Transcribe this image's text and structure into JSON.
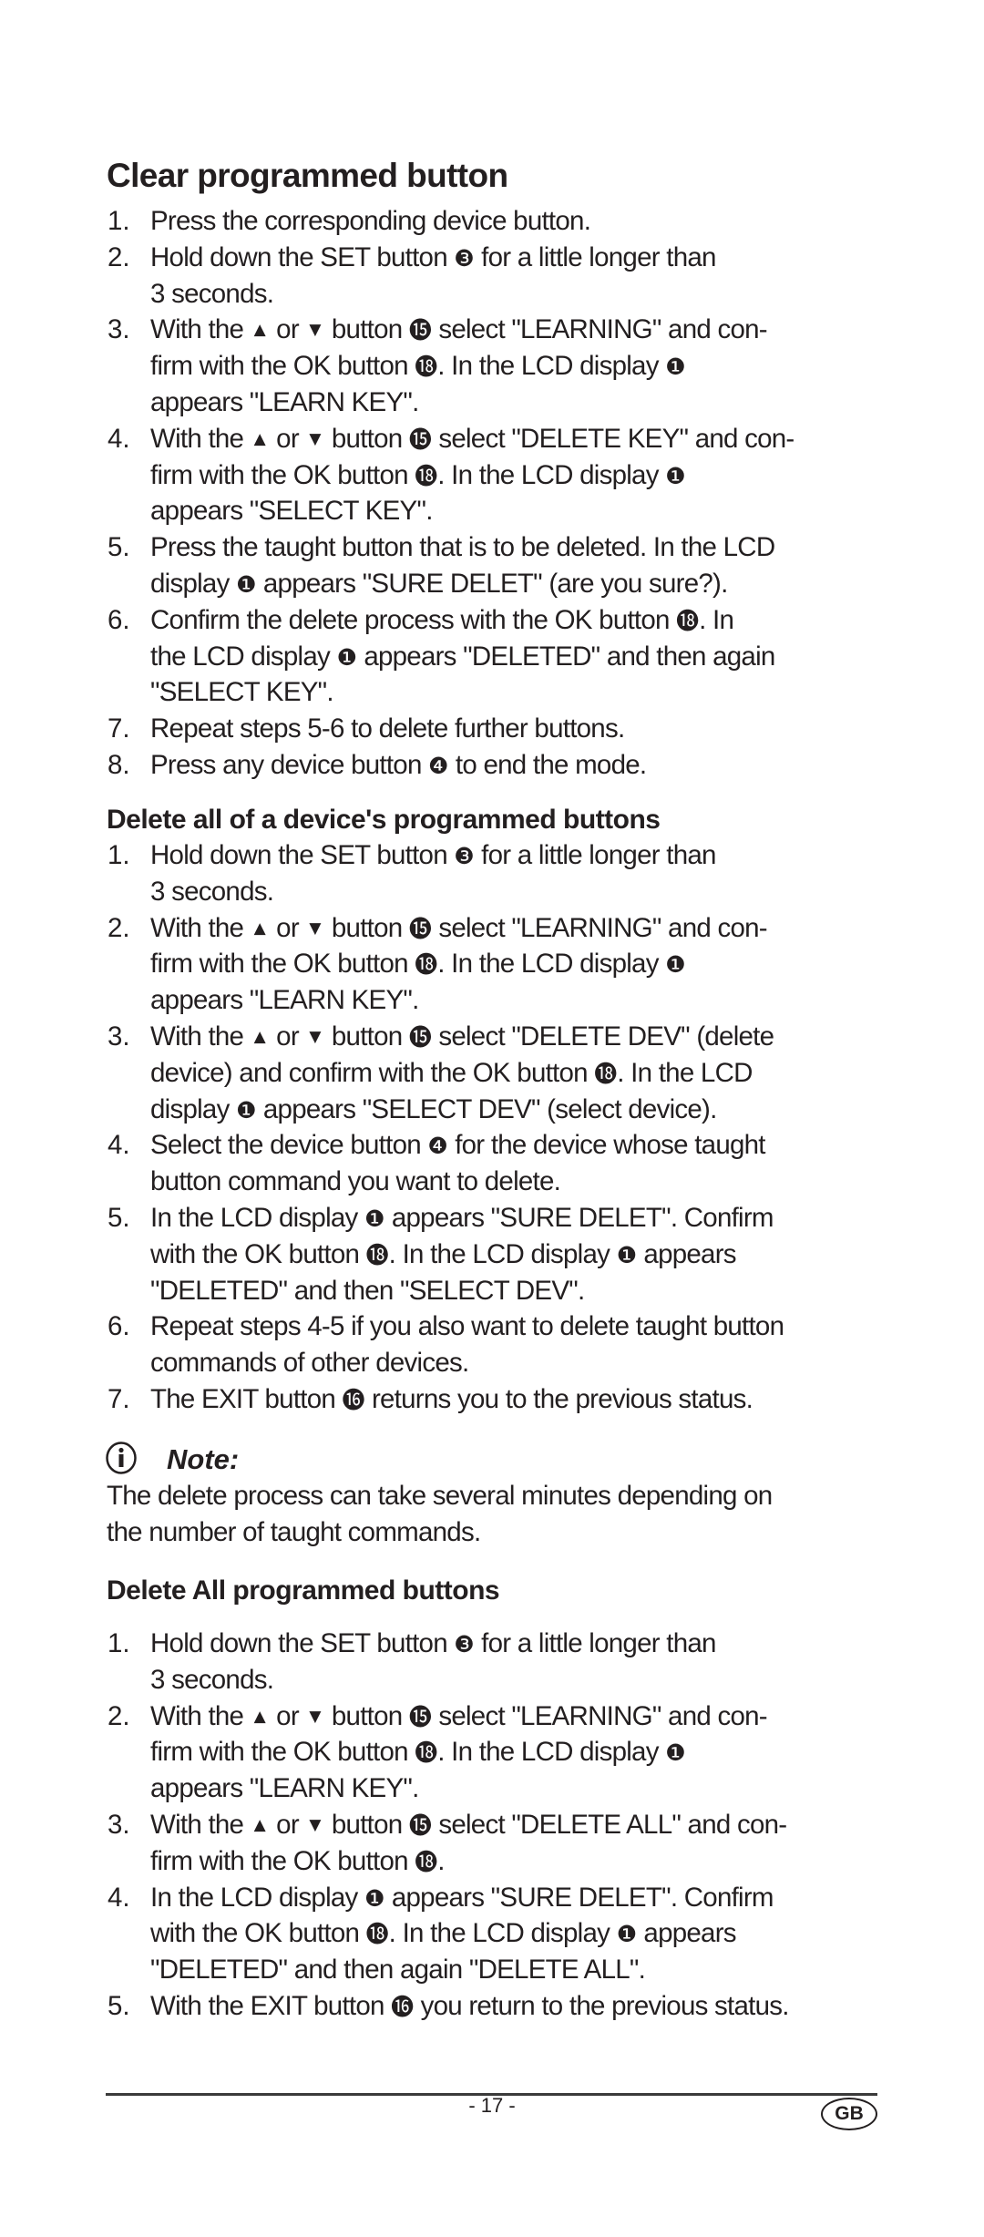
{
  "sections": [
    {
      "title": "Clear programmed button",
      "steps": [
        {
          "num": "1.",
          "lines": [
            [
              "Press the corresponding device button."
            ]
          ]
        },
        {
          "num": "2.",
          "lines": [
            [
              "Hold down the SET button ",
              {
                "ref": "3"
              },
              " for a little longer than"
            ],
            [
              "3 seconds."
            ]
          ]
        },
        {
          "num": "3.",
          "lines": [
            [
              "With the ",
              {
                "arrow": "up"
              },
              " or ",
              {
                "arrow": "down"
              },
              " button ",
              {
                "ref": "15"
              },
              " select \"LEARNING\" and con-"
            ],
            [
              "firm with the OK button ",
              {
                "ref": "18"
              },
              ". In the LCD display ",
              {
                "ref": "1"
              }
            ],
            [
              "appears \"LEARN KEY\"."
            ]
          ]
        },
        {
          "num": "4.",
          "lines": [
            [
              "With the ",
              {
                "arrow": "up"
              },
              " or ",
              {
                "arrow": "down"
              },
              " button ",
              {
                "ref": "15"
              },
              " select \"DELETE KEY\" and con-"
            ],
            [
              "firm with the OK button ",
              {
                "ref": "18"
              },
              ". In the LCD display ",
              {
                "ref": "1"
              }
            ],
            [
              "appears \"SELECT KEY\"."
            ]
          ]
        },
        {
          "num": "5.",
          "lines": [
            [
              "Press the taught button that is to be deleted. In the LCD"
            ],
            [
              "display ",
              {
                "ref": "1"
              },
              " appears \"SURE DELET\" (are you sure?)."
            ]
          ]
        },
        {
          "num": "6.",
          "lines": [
            [
              "Confirm the delete process with the OK button ",
              {
                "ref": "18"
              },
              ". In"
            ],
            [
              "the LCD display ",
              {
                "ref": "1"
              },
              " appears \"DELETED\" and then again"
            ],
            [
              "\"SELECT KEY\"."
            ]
          ]
        },
        {
          "num": "7.",
          "lines": [
            [
              "Repeat steps 5-6 to delete further buttons."
            ]
          ]
        },
        {
          "num": "8.",
          "lines": [
            [
              "Press any device button ",
              {
                "ref": "4"
              },
              " to end the mode."
            ]
          ]
        }
      ]
    },
    {
      "title": "Delete all of a device's programmed buttons",
      "steps": [
        {
          "num": "1.",
          "lines": [
            [
              "Hold down the SET button ",
              {
                "ref": "3"
              },
              " for a little longer than"
            ],
            [
              "3 seconds."
            ]
          ]
        },
        {
          "num": "2.",
          "lines": [
            [
              "With the ",
              {
                "arrow": "up"
              },
              " or ",
              {
                "arrow": "down"
              },
              " button ",
              {
                "ref": "15"
              },
              " select \"LEARNING\" and con-"
            ],
            [
              "firm with the OK button ",
              {
                "ref": "18"
              },
              ". In the LCD display ",
              {
                "ref": "1"
              }
            ],
            [
              "appears \"LEARN KEY\"."
            ]
          ]
        },
        {
          "num": "3.",
          "lines": [
            [
              "With the ",
              {
                "arrow": "up"
              },
              " or ",
              {
                "arrow": "down"
              },
              " button ",
              {
                "ref": "15"
              },
              " select \"DELETE DEV\" (delete"
            ],
            [
              "device) and confirm with the OK button ",
              {
                "ref": "18"
              },
              ". In the LCD"
            ],
            [
              "display ",
              {
                "ref": "1"
              },
              " appears \"SELECT DEV\" (select device)."
            ]
          ]
        },
        {
          "num": "4.",
          "lines": [
            [
              "Select the device button ",
              {
                "ref": "4"
              },
              " for the device whose taught"
            ],
            [
              "button command you want to delete."
            ]
          ]
        },
        {
          "num": "5.",
          "lines": [
            [
              "In the LCD display ",
              {
                "ref": "1"
              },
              " appears \"SURE DELET\". Confirm"
            ],
            [
              "with the OK button ",
              {
                "ref": "18"
              },
              ". In the LCD display ",
              {
                "ref": "1"
              },
              " appears"
            ],
            [
              "\"DELETED\" and then \"SELECT DEV\"."
            ]
          ]
        },
        {
          "num": "6.",
          "lines": [
            [
              "Repeat steps 4-5 if you also want to delete taught button"
            ],
            [
              "commands of other devices."
            ]
          ]
        },
        {
          "num": "7.",
          "lines": [
            [
              "The EXIT button ",
              {
                "ref": "16"
              },
              " returns you to the previous status."
            ]
          ]
        }
      ]
    },
    {
      "title": "Delete All programmed buttons",
      "steps": [
        {
          "num": "1.",
          "lines": [
            [
              "Hold down the SET button ",
              {
                "ref": "3"
              },
              " for a little longer than"
            ],
            [
              "3 seconds."
            ]
          ]
        },
        {
          "num": "2.",
          "lines": [
            [
              "With the ",
              {
                "arrow": "up"
              },
              " or ",
              {
                "arrow": "down"
              },
              " button ",
              {
                "ref": "15"
              },
              " select \"LEARNING\" and con-"
            ],
            [
              "firm with the OK button ",
              {
                "ref": "18"
              },
              ". In the LCD display ",
              {
                "ref": "1"
              }
            ],
            [
              "appears \"LEARN KEY\"."
            ]
          ]
        },
        {
          "num": "3.",
          "lines": [
            [
              "With the ",
              {
                "arrow": "up"
              },
              " or ",
              {
                "arrow": "down"
              },
              " button ",
              {
                "ref": "15"
              },
              " select \"DELETE ALL\" and con-"
            ],
            [
              "firm with the OK button ",
              {
                "ref": "18"
              },
              "."
            ]
          ]
        },
        {
          "num": "4.",
          "lines": [
            [
              "In the LCD display ",
              {
                "ref": "1"
              },
              " appears \"SURE DELET\". Confirm"
            ],
            [
              "with the OK button ",
              {
                "ref": "18"
              },
              ". In the LCD display ",
              {
                "ref": "1"
              },
              " appears"
            ],
            [
              "\"DELETED\" and then again \"DELETE ALL\"."
            ]
          ]
        },
        {
          "num": "5.",
          "lines": [
            [
              "With the EXIT button ",
              {
                "ref": "16"
              },
              " you return to the previous status."
            ]
          ]
        }
      ]
    }
  ],
  "note": {
    "icon": "info-icon",
    "label": "Note:",
    "lines": [
      "The delete process can take several minutes depending on",
      "the number of taught commands."
    ]
  },
  "ref_glyphs": {
    "1": "❶",
    "3": "❸",
    "4": "❹",
    "15": "⓯",
    "16": "⓰",
    "18": "⓲"
  },
  "arrow_glyphs": {
    "up": "▲",
    "down": "▼"
  },
  "footer": {
    "page_number": "- 17 -",
    "language_badge": "GB"
  }
}
